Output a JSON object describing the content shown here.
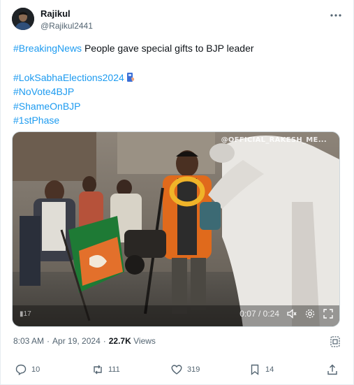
{
  "user": {
    "name": "Rajikul",
    "handle": "@Rajikul2441"
  },
  "tweet": {
    "line1_tag": "#BreakingNews",
    "line1_text": " People gave special gifts to BJP leader",
    "hashtags": [
      "#LokSabhaElections2024",
      "#NoVote4BJP",
      "#ShameOnBJP",
      "#1stPhase"
    ]
  },
  "media": {
    "watermark": "@OFFICIAL_RAKESH_ME...",
    "watermark_left": "▮17",
    "time": "0:07 / 0:24"
  },
  "meta": {
    "time": "8:03 AM",
    "date": "Apr 19, 2024",
    "views_count": "22.7K",
    "views_label": "Views"
  },
  "actions": {
    "replies": "10",
    "reposts": "111",
    "likes": "319",
    "bookmarks": "14"
  },
  "colors": {
    "link": "#1d9bf0",
    "text": "#0f1419",
    "muted": "#536471"
  }
}
